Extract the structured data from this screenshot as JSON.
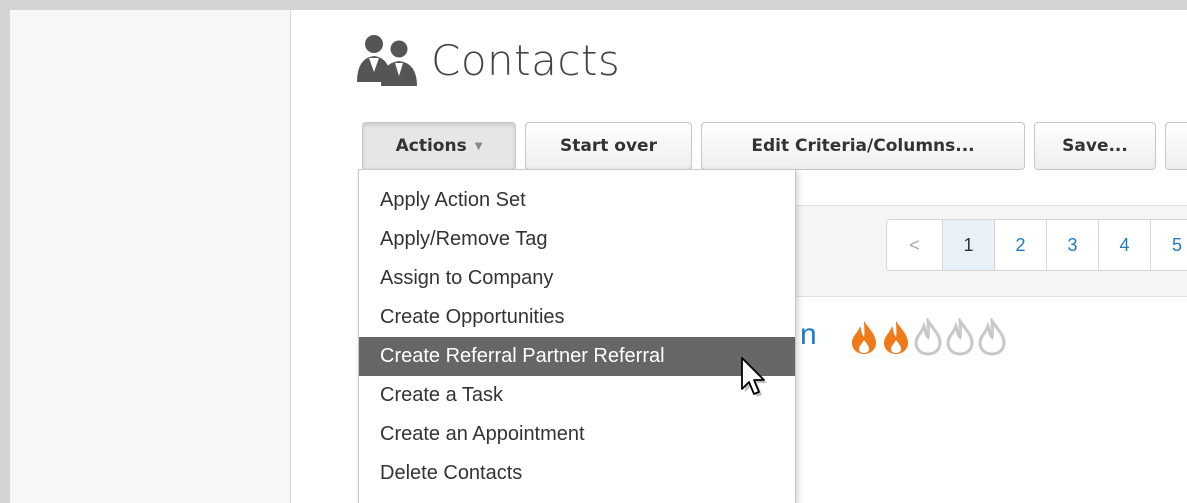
{
  "page": {
    "title": "Contacts"
  },
  "toolbar": {
    "actions_label": "Actions",
    "start_over_label": "Start over",
    "edit_criteria_label": "Edit Criteria/Columns...",
    "save_label": "Save..."
  },
  "actions_menu": {
    "items": [
      {
        "label": "Apply Action Set"
      },
      {
        "label": "Apply/Remove Tag"
      },
      {
        "label": "Assign to Company"
      },
      {
        "label": "Create Opportunities"
      },
      {
        "label": "Create Referral Partner Referral",
        "highlighted": true
      },
      {
        "label": "Create a Task"
      },
      {
        "label": "Create an Appointment"
      },
      {
        "label": "Delete Contacts"
      }
    ]
  },
  "pagination": {
    "prev_label": "<",
    "pages": [
      "1",
      "2",
      "3",
      "4",
      "5"
    ],
    "current": "1"
  },
  "contact": {
    "name_fragment": "n",
    "score": {
      "value": 2,
      "max": 5
    }
  },
  "colors": {
    "flame_active": "#f07a1a",
    "flame_inactive": "#c8c8c8",
    "link": "#1e7bc4",
    "menu_highlight": "#666666"
  },
  "icons": {
    "title": "contacts-people-icon",
    "cursor": "mouse-pointer-icon"
  }
}
